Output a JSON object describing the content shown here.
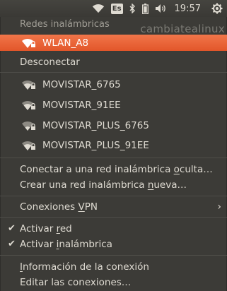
{
  "panel": {
    "keyboard_layout": "Es",
    "clock": "19:57",
    "icons": [
      "wifi-icon",
      "keyboard-layout-indicator",
      "bluetooth-icon",
      "battery-icon",
      "volume-icon",
      "gear-icon"
    ]
  },
  "watermark": "cambiatealinux",
  "menu": {
    "header": "Redes inalámbricas",
    "active_network": "WLAN_A8",
    "disconnect": "Desconectar",
    "networks": [
      "MOVISTAR_6765",
      "MOVISTAR_91EE",
      "MOVISTAR_PLUS_6765",
      "MOVISTAR_PLUS_91EE"
    ],
    "hidden_network": {
      "prefix": "Conectar a una red inalámbrica ",
      "accel": "o",
      "suffix": "culta…"
    },
    "new_network": {
      "prefix": "Crear una red inalámbrica ",
      "accel": "n",
      "suffix": "ueva…"
    },
    "vpn": {
      "prefix": "Conexiones ",
      "accel": "V",
      "suffix": "PN"
    },
    "enable_network": {
      "prefix": "Activar ",
      "accel": "r",
      "suffix": "ed"
    },
    "enable_wireless": {
      "prefix": "Activar ",
      "accel": "i",
      "suffix": "nalámbrica"
    },
    "connection_info": {
      "prefix": "",
      "accel": "I",
      "suffix": "nformación de la conexión"
    },
    "edit_connections": {
      "prefix": "Editar las conexiones…",
      "accel": "",
      "suffix": ""
    }
  },
  "colors": {
    "highlight": "#e95420",
    "menu_bg": "#3c3b37",
    "text": "#dfdbd2"
  }
}
